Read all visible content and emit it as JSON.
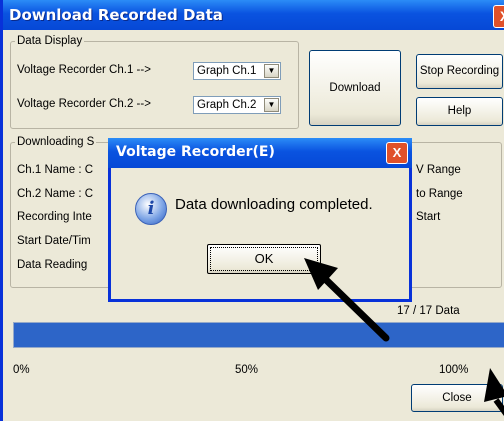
{
  "window": {
    "title": "Download Recorded Data",
    "close_glyph": "X"
  },
  "data_display": {
    "legend": "Data Display",
    "ch1_label": "Voltage Recorder Ch.1 -->",
    "ch2_label": "Voltage Recorder Ch.2 -->",
    "ch1_select": "Graph Ch.1",
    "ch2_select": "Graph Ch.2",
    "dropdown_glyph": "▼"
  },
  "buttons": {
    "download": "Download",
    "stop_recording": "Stop Recording",
    "help": "Help",
    "close": "Close"
  },
  "downloading": {
    "legend_fragment": "Downloading S",
    "ch1_name": "Ch.1 Name : C",
    "ch2_name": "Ch.2 Name : C",
    "recording_interval": "Recording Inte",
    "start_date": "Start Date/Tim",
    "data_reading": "Data Reading",
    "right_range1": "V Range",
    "right_range2": "to Range",
    "right_start": "Start"
  },
  "progress": {
    "count_text": "17 / 17 Data",
    "fraction": 1.0,
    "tick_0": "0%",
    "tick_50": "50%",
    "tick_100": "100%"
  },
  "dialog": {
    "title": "Voltage Recorder(E)",
    "close_glyph": "X",
    "icon": "i",
    "message": "Data downloading completed.",
    "ok": "OK"
  },
  "colors": {
    "title_bar": "#0a53e0",
    "progress_fill": "#2d65c8",
    "close_button": "#e0512a"
  }
}
